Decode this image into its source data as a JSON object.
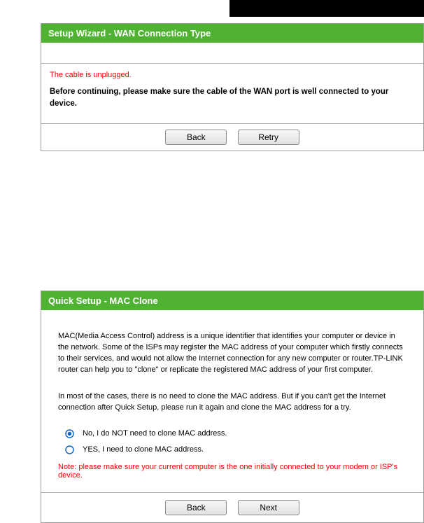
{
  "top": {},
  "panel1": {
    "title": "Setup Wizard - WAN Connection Type",
    "error": "The cable is unplugged.",
    "message": "Before continuing, please make sure the cable of the WAN port is well connected to your device.",
    "buttons": {
      "back": "Back",
      "retry": "Retry"
    }
  },
  "panel2": {
    "title": "Quick Setup - MAC Clone",
    "para1": "MAC(Media Access Control) address is a unique identifier that identifies your computer or device in the network. Some of the ISPs may register the MAC address of your computer which firstly connects to their services, and would not allow the Internet connection for any new computer or router.TP-LINK router can help you to \"clone\" or replicate the registered MAC address of your first computer.",
    "para2": "In most of the cases, there is no need to clone the MAC address. But if you can't get the Internet connection after Quick Setup, please run it again and clone the MAC address for a try.",
    "options": {
      "no_clone": "No, I do NOT need to clone MAC address.",
      "yes_clone": "YES, I need to clone MAC address."
    },
    "note": "Note: please make sure your current computer is the one initially connected to your modem or ISP's device.",
    "buttons": {
      "back": "Back",
      "next": "Next"
    }
  },
  "colors": {
    "accent": "#4fb233",
    "error": "#ff0000"
  }
}
